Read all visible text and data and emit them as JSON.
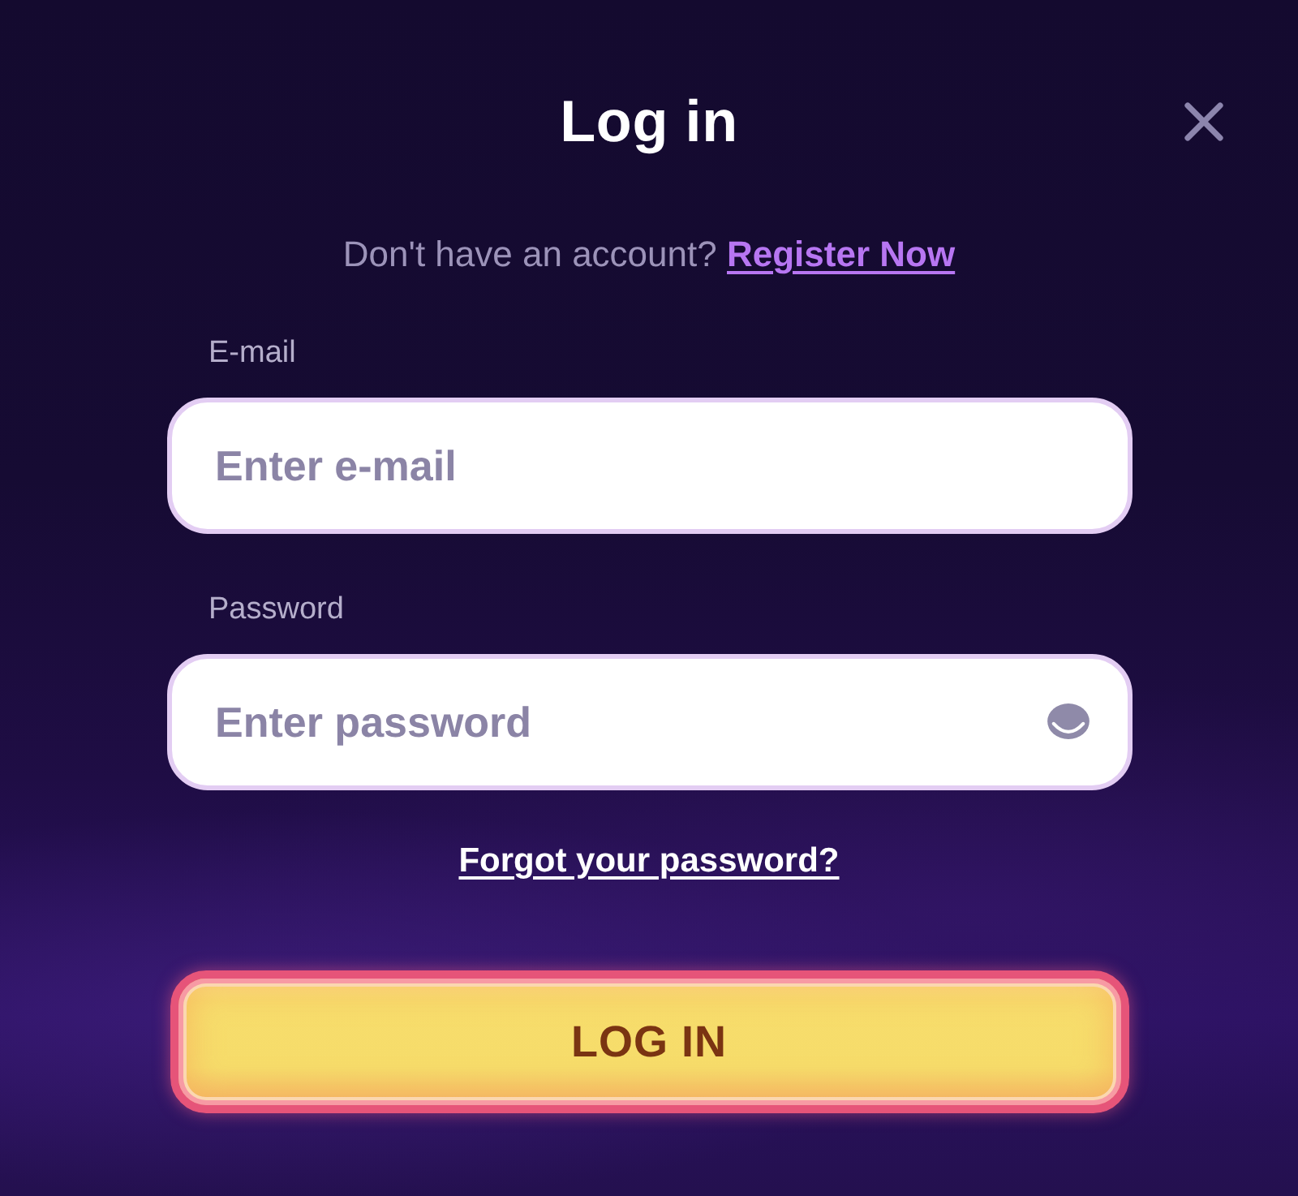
{
  "dialog": {
    "title": "Log in"
  },
  "register_prompt": {
    "text": "Don't have an account?",
    "link": "Register Now"
  },
  "fields": [
    {
      "kind": "email",
      "label": "E-mail",
      "placeholder": "Enter e-mail"
    },
    {
      "kind": "password",
      "label": "Password",
      "placeholder": "Enter password"
    }
  ],
  "forgot_link": "Forgot your password?",
  "submit_button": "LOG IN"
}
